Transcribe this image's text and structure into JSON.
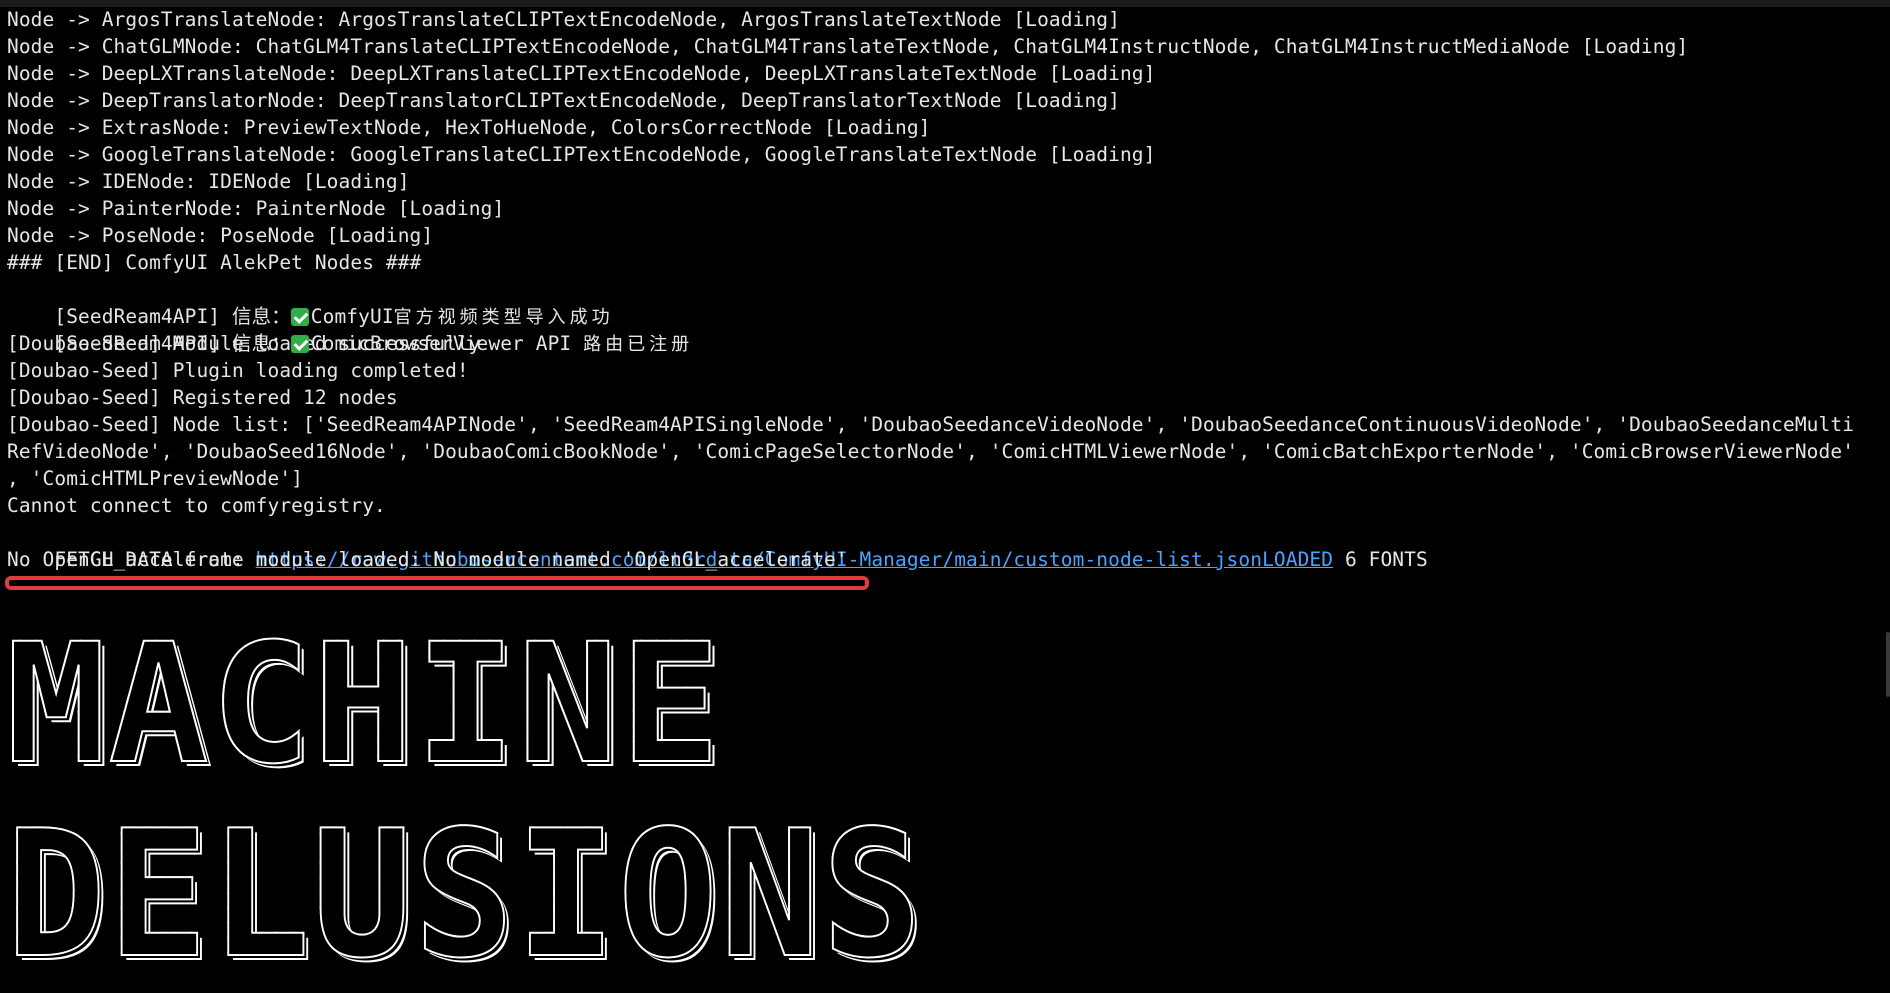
{
  "terminal": {
    "lines": [
      "Node -> ArgosTranslateNode: ArgosTranslateCLIPTextEncodeNode, ArgosTranslateTextNode [Loading]",
      "Node -> ChatGLMNode: ChatGLM4TranslateCLIPTextEncodeNode, ChatGLM4TranslateTextNode, ChatGLM4InstructNode, ChatGLM4InstructMediaNode [Loading]",
      "Node -> DeepLXTranslateNode: DeepLXTranslateCLIPTextEncodeNode, DeepLXTranslateTextNode [Loading]",
      "Node -> DeepTranslatorNode: DeepTranslatorCLIPTextEncodeNode, DeepTranslatorTextNode [Loading]",
      "Node -> ExtrasNode: PreviewTextNode, HexToHueNode, ColorsCorrectNode [Loading]",
      "Node -> GoogleTranslateNode: GoogleTranslateCLIPTextEncodeNode, GoogleTranslateTextNode [Loading]",
      "Node -> IDENode: IDENode [Loading]",
      "Node -> PainterNode: PainterNode [Loading]",
      "Node -> PoseNode: PoseNode [Loading]",
      "### [END] ComfyUI AlekPet Nodes ###"
    ],
    "seed_lines": [
      {
        "prefix": "[SeedReam4API] 信息：",
        "icon": "green-check-icon",
        "text_latin": "ComfyUI",
        "text_cjk": "官方视频类型导入成功"
      },
      {
        "prefix": "[SeedReam4API] 信息：",
        "icon": "green-check-icon",
        "text_latin": "ComicBrowserViewer API ",
        "text_cjk": "路由已注册"
      }
    ],
    "doubao_lines": [
      "[Doubao-Seed] Module loaded successfully",
      "[Doubao-Seed] Plugin loading completed!",
      "[Doubao-Seed] Registered 12 nodes"
    ],
    "node_list_lines": [
      "[Doubao-Seed] Node list: ['SeedReam4APINode', 'SeedReam4APISingleNode', 'DoubaoSeedanceVideoNode', 'DoubaoSeedanceContinuousVideoNode', 'DoubaoSeedanceMulti",
      "RefVideoNode', 'DoubaoSeed16Node', 'DoubaoComicBookNode', 'ComicPageSelectorNode', 'ComicHTMLViewerNode', 'ComicBatchExporterNode', 'ComicBrowserViewerNode'",
      ", 'ComicHTMLPreviewNode']"
    ],
    "cannot_connect": "Cannot connect to comfyregistry.",
    "fetch": {
      "prefix": "FETCH DATA from: ",
      "url": "https://raw.githubusercontent.com/ltdrdata/ComfyUI-Manager/main/custom-node-list.json",
      "loaded": "LOADED",
      "suffix": " 6 FONTS"
    },
    "opengl_line": "No OpenGL_accelerate module loaded: No module named 'OpenGL_accelerate'",
    "banner": {
      "line1": "MACHINE",
      "line2": "DELUSIONS"
    },
    "colors": {
      "background": "#000000",
      "text": "#e6e6e6",
      "link": "#4aa3ff",
      "highlight": "#e23b3b",
      "check": "#2fae4a"
    }
  }
}
